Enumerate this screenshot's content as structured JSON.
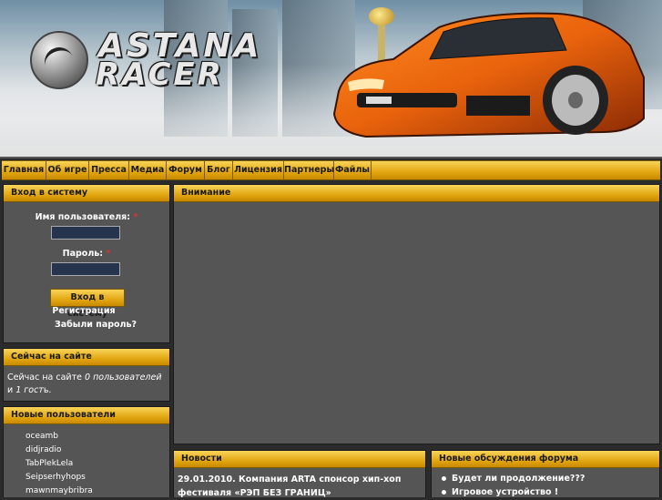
{
  "banner": {
    "logo_line1": "ASTANA",
    "logo_line2": "RACER",
    "car_color": "#e8620c"
  },
  "nav": [
    {
      "label": "Главная",
      "name": "nav-home"
    },
    {
      "label": "Об игре",
      "name": "nav-about"
    },
    {
      "label": "Пресса",
      "name": "nav-press"
    },
    {
      "label": "Медиа",
      "name": "nav-media"
    },
    {
      "label": "Форум",
      "name": "nav-forum"
    },
    {
      "label": "Блог",
      "name": "nav-blog"
    },
    {
      "label": "Лицензия",
      "name": "nav-license"
    },
    {
      "label": "Партнеры",
      "name": "nav-partners"
    },
    {
      "label": "Файлы",
      "name": "nav-files"
    }
  ],
  "login": {
    "title": "Вход в систему",
    "username_label": "Имя пользователя:",
    "password_label": "Пароль:",
    "required_mark": "*",
    "username_value": "",
    "password_value": "",
    "submit": "Вход в систему",
    "register": "Регистрация",
    "forgot": "Забыли пароль?"
  },
  "online": {
    "title": "Сейчас на сайте",
    "text_prefix": "Сейчас на сайте ",
    "users_count": "0 пользователей",
    "middle": " и ",
    "guests_count": "1 гост",
    "suffix": "ь."
  },
  "new_users": {
    "title": "Новые пользователи",
    "items": [
      "oceamb",
      "didjradio",
      "TabPlekLela",
      "Seipserhyhops",
      "mawnmaybribra"
    ]
  },
  "attention": {
    "title": "Внимание"
  },
  "news": {
    "title": "Новости",
    "item": "29.01.2010. Компания ARTA спонсор хип-хоп фестиваля «РЭП БЕЗ ГРАНИЦ»"
  },
  "forum": {
    "title": "Новые обсуждения форума",
    "items": [
      "Будет ли продолжение???",
      "Игровое устройство !"
    ]
  },
  "colors": {
    "accent": "#e2a712",
    "panel_bg": "#555555",
    "page_bg": "#2b2b2b",
    "input_bg": "#26344e"
  }
}
